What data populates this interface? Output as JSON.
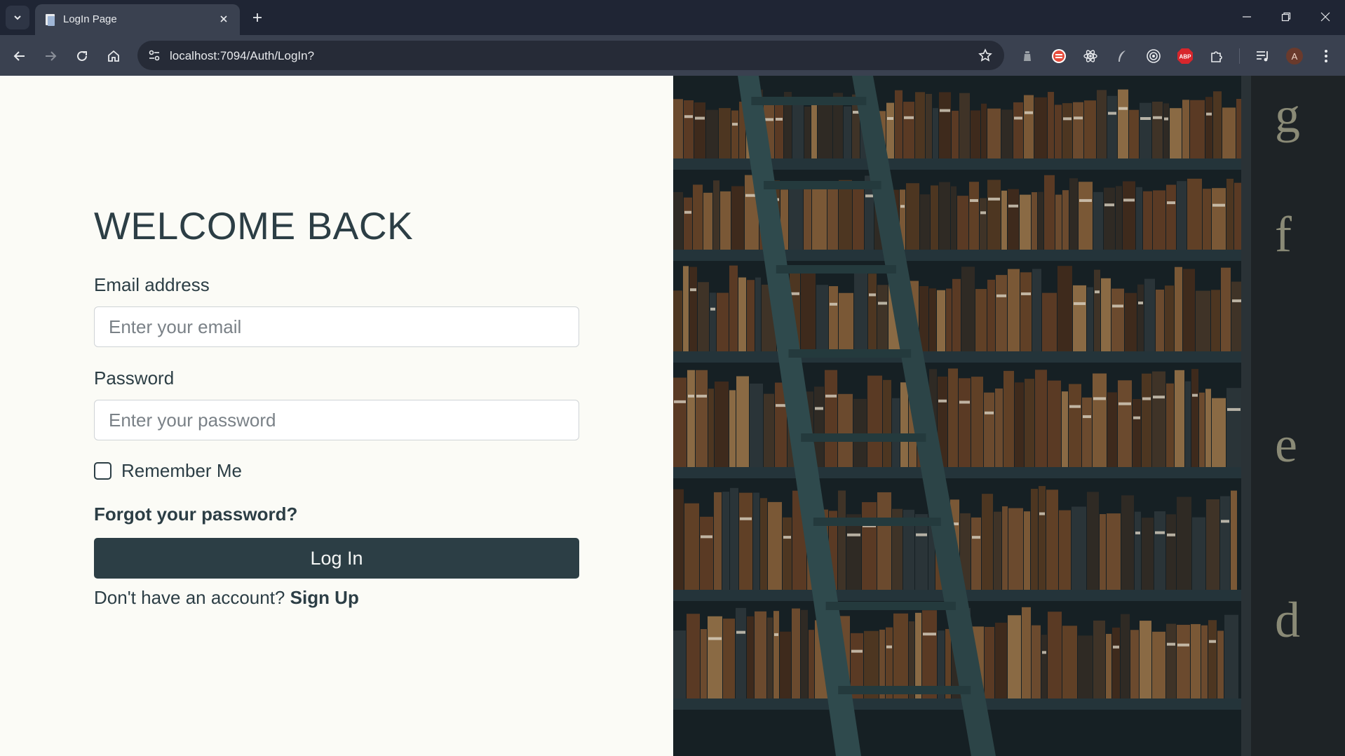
{
  "browser": {
    "tab_title": "LogIn Page",
    "url": "localhost:7094/Auth/LogIn?",
    "profile_initial": "A",
    "abp_label": "ABP"
  },
  "page": {
    "heading": "WELCOME BACK",
    "email_label": "Email address",
    "email_placeholder": "Enter your email",
    "password_label": "Password",
    "password_placeholder": "Enter your password",
    "remember_label": "Remember Me",
    "forgot_link": "Forgot your password?",
    "login_button": "Log In",
    "signup_prompt": "Don't have an account?",
    "signup_link": "Sign Up"
  },
  "image": {
    "alt": "Library bookshelves with a rolling ladder",
    "shelf_letters": [
      "g",
      "f",
      "e",
      "d"
    ]
  },
  "colors": {
    "primary": "#2c3e45",
    "background": "#fbfbf6",
    "chrome_dark": "#1f2534",
    "chrome_toolbar": "#3a4150"
  }
}
